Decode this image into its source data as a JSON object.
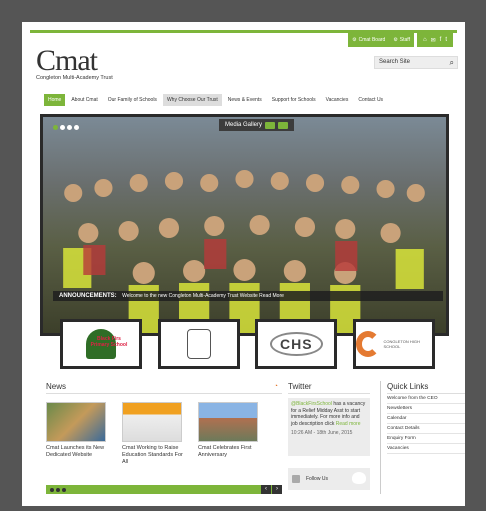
{
  "topbar": {
    "board_label": "Cmat Board",
    "staff_label": "Staff",
    "icons": [
      "home-icon",
      "mail-icon",
      "facebook-icon",
      "twitter-icon"
    ],
    "icon_glyphs": [
      "⌂",
      "✉",
      "f",
      "t"
    ]
  },
  "logo": {
    "title": "Cmat",
    "subtitle": "Congleton Multi-Academy Trust"
  },
  "search": {
    "placeholder": "Search Site"
  },
  "nav": {
    "items": [
      "Home",
      "About Cmat",
      "Our Family of Schools",
      "Why Choose Our Trust",
      "News & Events",
      "Support for Schools",
      "Vacancies",
      "Contact Us"
    ]
  },
  "hero": {
    "media_gallery": "Media Gallery",
    "announcement_label": "ANNOUNCEMENTS:",
    "announcement_text": "Welcome to the new Congleton Multi-Academy Trust Website Read More"
  },
  "schools": {
    "school1_text": "Black Firs Primary School",
    "school3_text": "CHS",
    "school4_text": "CONGLETON HIGH SCHOOL"
  },
  "news": {
    "title": "News",
    "items": [
      {
        "caption": "Cmat Launches its New Dedicated Website"
      },
      {
        "caption": "Cmat Working to Raise Education Standards For All"
      },
      {
        "caption": "Cmat Celebrates First Anniversary"
      }
    ]
  },
  "twitter": {
    "title": "Twitter",
    "handle": "@BlackFirsSchool",
    "tweet": "has a vacancy for a Relief Midday Asst to start immediately. For more info and job description click",
    "read_more": "Read more",
    "time": "10:26 AM - 18th June, 2015",
    "follow": "Follow Us"
  },
  "quick_links": {
    "title": "Quick Links",
    "items": [
      "Welcome from the CEO",
      "Newsletters",
      "Calendar",
      "Contact Details",
      "Enquiry Form",
      "Vacancies"
    ]
  },
  "colors": {
    "accent": "#7db53a",
    "frame": "#555555",
    "dark": "#2a2a2a"
  }
}
